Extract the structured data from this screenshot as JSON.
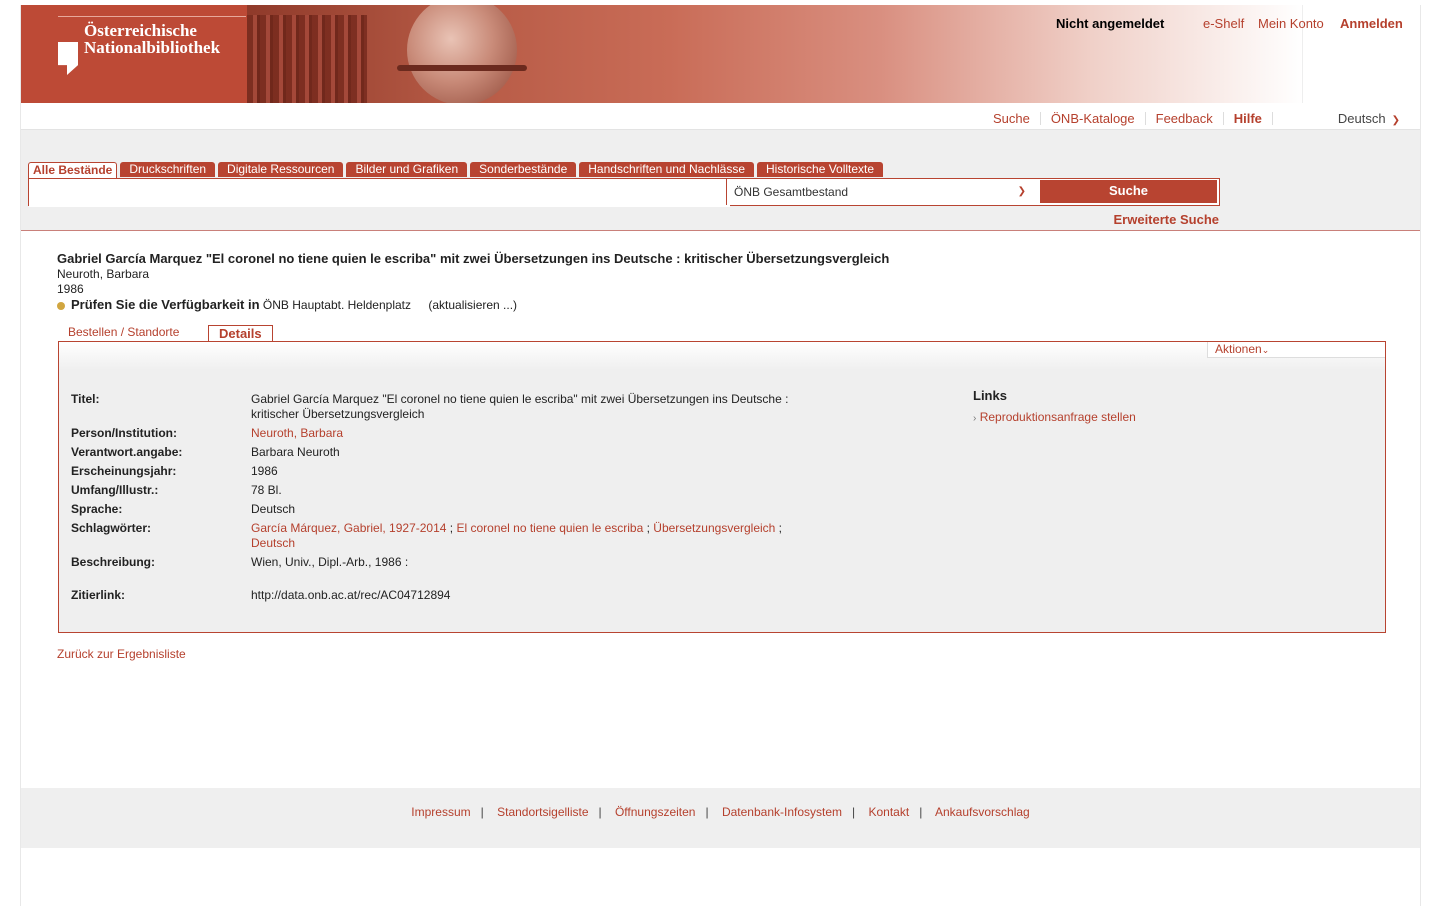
{
  "header": {
    "logo_line1": "Österreichische",
    "logo_line2": "Nationalbibliothek",
    "status": "Nicht angemeldet",
    "eshelf": "e-Shelf",
    "account": "Mein Konto",
    "login": "Anmelden"
  },
  "nav": {
    "items": [
      "Suche",
      "ÖNB-Kataloge",
      "Feedback",
      "Hilfe"
    ],
    "language": "Deutsch"
  },
  "search": {
    "tabs": [
      "Alle Bestände",
      "Druckschriften",
      "Digitale Ressourcen",
      "Bilder und Grafiken",
      "Sonderbestände",
      "Handschriften und Nachlässe",
      "Historische Volltexte"
    ],
    "active_tab": "Alle Bestände",
    "query": "",
    "scope": "ÖNB Gesamtbestand",
    "button": "Suche",
    "advanced": "Erweiterte Suche"
  },
  "record": {
    "title": "Gabriel García Marquez \"El coronel no tiene quien le escriba\" mit zwei Übersetzungen ins Deutsche : kritischer Übersetzungsvergleich",
    "author": "Neuroth, Barbara",
    "year": "1986",
    "availability_label": "Prüfen Sie die Verfügbarkeit in",
    "availability_location": "ÖNB Hauptabt. Heldenplatz",
    "refresh": "(aktualisieren ...)"
  },
  "detail_tabs": {
    "order": "Bestellen / Standorte",
    "details": "Details"
  },
  "actions_label": "Aktionen",
  "fields": {
    "titel_label": "Titel:",
    "titel_value": "Gabriel García Marquez \"El coronel no tiene quien le escriba\" mit zwei Übersetzungen ins Deutsche :",
    "titel_value2": "kritischer Übersetzungsvergleich",
    "person_label": "Person/Institution:",
    "person_value": "Neuroth, Barbara",
    "verant_label": "Verantwort.angabe:",
    "verant_value": "Barbara Neuroth",
    "jahr_label": "Erscheinungsjahr:",
    "jahr_value": "1986",
    "umfang_label": "Umfang/Illustr.:",
    "umfang_value": "78 Bl.",
    "sprache_label": "Sprache:",
    "sprache_value": "Deutsch",
    "schlag_label": "Schlagwörter:",
    "schlag_values": [
      "García Márquez, Gabriel, 1927-2014",
      "El coronel no tiene quien le escriba",
      "Übersetzungsvergleich",
      "Deutsch"
    ],
    "beschr_label": "Beschreibung:",
    "beschr_value": "Wien, Univ., Dipl.-Arb., 1986 :",
    "zitier_label": "Zitierlink:",
    "zitier_value": "http://data.onb.ac.at/rec/AC04712894"
  },
  "links": {
    "title": "Links",
    "repro": "Reproduktionsanfrage stellen"
  },
  "back_link": "Zurück zur Ergebnisliste",
  "footer": [
    "Impressum",
    "Standortsigelliste",
    "Öffnungszeiten",
    "Datenbank-Infosystem",
    "Kontakt",
    "Ankaufsvorschlag"
  ],
  "colors": {
    "accent": "#b84431",
    "band": "#efefef"
  }
}
